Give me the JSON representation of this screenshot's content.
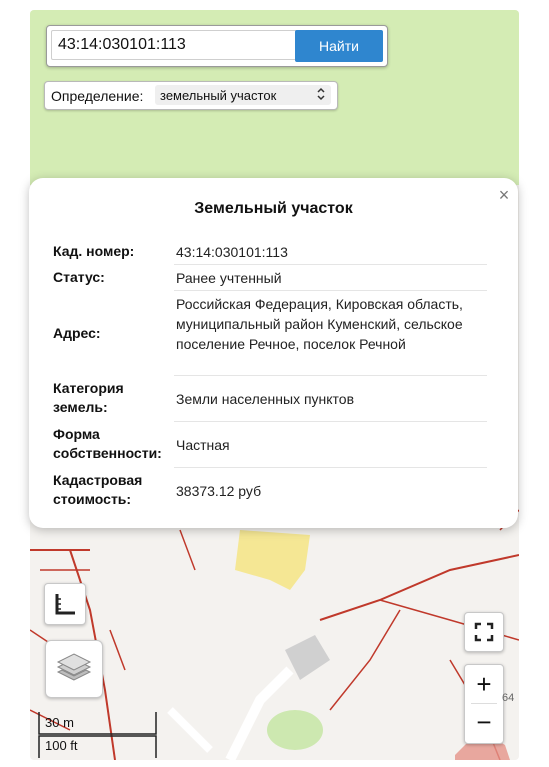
{
  "search": {
    "query": "43:14:030101:113",
    "button_label": "Найти"
  },
  "definition": {
    "label": "Определение:",
    "selected": "земельный участок"
  },
  "popup": {
    "title": "Земельный участок",
    "close_glyph": "×",
    "fields": [
      {
        "key": "Кад. номер:",
        "value": "43:14:030101:113"
      },
      {
        "key": "Статус:",
        "value": "Ранее учтенный"
      },
      {
        "key": "Адрес:",
        "value": "Российская Федерация, Кировская область, муниципальный район Куменский, сельское поселение Речное, поселок Речной"
      },
      {
        "key_lines": [
          "Категория",
          "земель:"
        ],
        "value": "Земли населенных пунктов"
      },
      {
        "key_lines": [
          "Форма",
          "собственности:"
        ],
        "value": "Частная"
      },
      {
        "key_lines": [
          "Кадастровая",
          "стоимость:"
        ],
        "value": "38373.12 руб"
      }
    ]
  },
  "controls": {
    "ruler_icon": "ruler-icon",
    "layers_icon": "layers-icon",
    "fullscreen_icon": "fullscreen-icon",
    "zoom_in": "+",
    "zoom_out": "−"
  },
  "scale": {
    "metric": "30 m",
    "imperial": "100 ft"
  },
  "map_label": "64",
  "colors": {
    "accent": "#2f86cf",
    "map_green": "#d4ecb4",
    "parcel_line": "#c0392b",
    "highlight_yellow": "#f5e58a"
  }
}
